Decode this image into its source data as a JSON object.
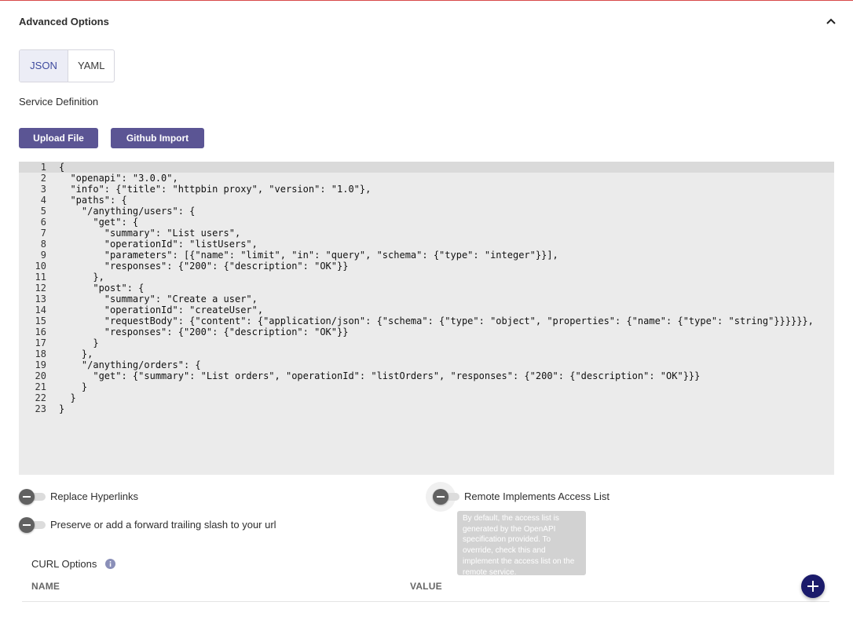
{
  "section": {
    "title": "Advanced Options",
    "collapse_icon": "chevron-up-icon"
  },
  "format_tabs": [
    {
      "label": "JSON",
      "active": true
    },
    {
      "label": "YAML",
      "active": false
    }
  ],
  "service_definition": {
    "label": "Service Definition",
    "upload_label": "Upload File",
    "github_label": "Github Import"
  },
  "editor": {
    "lines": [
      {
        "n": "1",
        "text": "{"
      },
      {
        "n": "2",
        "text": "  \"openapi\": \"3.0.0\","
      },
      {
        "n": "3",
        "text": "  \"info\": {\"title\": \"httpbin proxy\", \"version\": \"1.0\"},"
      },
      {
        "n": "4",
        "text": "  \"paths\": {"
      },
      {
        "n": "5",
        "text": "    \"/anything/users\": {"
      },
      {
        "n": "6",
        "text": "      \"get\": {"
      },
      {
        "n": "7",
        "text": "        \"summary\": \"List users\","
      },
      {
        "n": "8",
        "text": "        \"operationId\": \"listUsers\","
      },
      {
        "n": "9",
        "text": "        \"parameters\": [{\"name\": \"limit\", \"in\": \"query\", \"schema\": {\"type\": \"integer\"}}],"
      },
      {
        "n": "10",
        "text": "        \"responses\": {\"200\": {\"description\": \"OK\"}}"
      },
      {
        "n": "11",
        "text": "      },"
      },
      {
        "n": "12",
        "text": "      \"post\": {"
      },
      {
        "n": "13",
        "text": "        \"summary\": \"Create a user\","
      },
      {
        "n": "14",
        "text": "        \"operationId\": \"createUser\","
      },
      {
        "n": "15",
        "text": "        \"requestBody\": {\"content\": {\"application/json\": {\"schema\": {\"type\": \"object\", \"properties\": {\"name\": {\"type\": \"string\"}}}}}},"
      },
      {
        "n": "16",
        "text": "        \"responses\": {\"200\": {\"description\": \"OK\"}}"
      },
      {
        "n": "17",
        "text": "      }"
      },
      {
        "n": "18",
        "text": "    },"
      },
      {
        "n": "19",
        "text": "    \"/anything/orders\": {"
      },
      {
        "n": "20",
        "text": "      \"get\": {\"summary\": \"List orders\", \"operationId\": \"listOrders\", \"responses\": {\"200\": {\"description\": \"OK\"}}}"
      },
      {
        "n": "21",
        "text": "    }"
      },
      {
        "n": "22",
        "text": "  }"
      },
      {
        "n": "23",
        "text": "}"
      }
    ]
  },
  "toggles": {
    "replace_hyperlinks": {
      "label": "Replace Hyperlinks",
      "checked": false
    },
    "trailing_slash": {
      "label": "Preserve or add a forward trailing slash to your url",
      "checked": false
    },
    "remote_access_list": {
      "label": "Remote Implements Access List",
      "checked": false
    }
  },
  "tooltip": {
    "text": "By default, the access list is generated by the OpenAPI specification provided. To override, check this and implement the access list on the remote service."
  },
  "curl": {
    "label": "CURL Options",
    "info_icon": "info-icon",
    "columns": [
      "NAME",
      "VALUE"
    ],
    "add_icon": "plus-icon"
  },
  "colors": {
    "accent_button": "#5b5594",
    "add_button": "#1b1b6b",
    "active_tab_text": "#3e4a9e",
    "editor_bg": "#ebebeb"
  }
}
